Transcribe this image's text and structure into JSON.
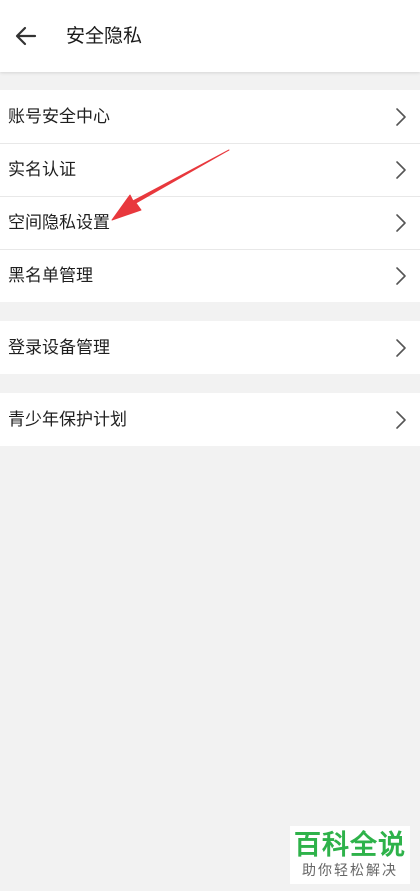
{
  "header": {
    "title": "安全隐私",
    "back_icon": "arrow-left-icon"
  },
  "groups": [
    {
      "items": [
        {
          "label": "账号安全中心"
        },
        {
          "label": "实名认证"
        },
        {
          "label": "空间隐私设置"
        },
        {
          "label": "黑名单管理"
        }
      ]
    },
    {
      "items": [
        {
          "label": "登录设备管理"
        }
      ]
    },
    {
      "items": [
        {
          "label": "青少年保护计划"
        }
      ]
    }
  ],
  "chevron_icon": "chevron-right-icon",
  "annotation": {
    "type": "red-arrow",
    "points_to": "空间隐私设置",
    "color": "#e8383d"
  },
  "watermark": {
    "title": "百科全说",
    "subtitle": "助你轻松解决",
    "color": "#2eb24a"
  }
}
